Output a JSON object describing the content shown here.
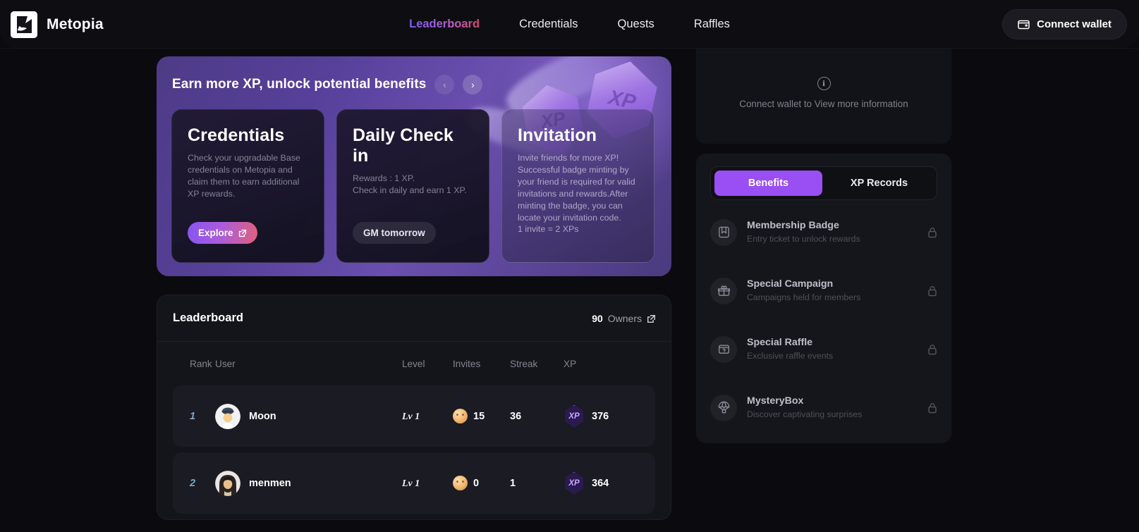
{
  "brand": {
    "name": "Metopia",
    "logo_icon": "metopia-logo-icon"
  },
  "nav": {
    "items": [
      {
        "label": "Leaderboard",
        "active": true
      },
      {
        "label": "Credentials",
        "active": false
      },
      {
        "label": "Quests",
        "active": false
      },
      {
        "label": "Raffles",
        "active": false
      }
    ],
    "wallet_button": {
      "label": "Connect wallet",
      "icon": "wallet-icon"
    }
  },
  "banner": {
    "title": "Earn more XP, unlock potential benefits",
    "prev_label": "‹",
    "next_label": "›",
    "cards": [
      {
        "title": "Credentials",
        "body": "Check your upgradable Base credentials on Metopia and claim them to earn additional XP rewards.",
        "action": "Explore",
        "action_style": "gradient"
      },
      {
        "title": "Daily Check in",
        "body": "Rewards : 1 XP.\nCheck in daily and earn 1 XP.",
        "action": "GM tomorrow",
        "action_style": "ghost"
      },
      {
        "title": "Invitation",
        "body": "Invite friends for more XP! Successful badge minting by your friend is required for valid invitations and rewards.After minting the badge, you can locate your invitation code.\n1 invite = 2 XPs",
        "action": "",
        "action_style": "none"
      }
    ]
  },
  "leaderboard": {
    "title": "Leaderboard",
    "owners_count": "90",
    "owners_label": "Owners",
    "columns": [
      "Rank",
      "User",
      "Level",
      "Invites",
      "Streak",
      "XP"
    ],
    "rows": [
      {
        "rank": "1",
        "user": "Moon",
        "level": "Lv 1",
        "invites": "15",
        "streak": "36",
        "xp": "376",
        "xp_badge": "XP"
      },
      {
        "rank": "2",
        "user": "menmen",
        "level": "Lv 1",
        "invites": "0",
        "streak": "1",
        "xp": "364",
        "xp_badge": "XP"
      }
    ]
  },
  "side": {
    "notice": "Connect wallet to View more information",
    "notice_icon": "info-icon",
    "tabs": [
      {
        "label": "Benefits",
        "active": true
      },
      {
        "label": "XP Records",
        "active": false
      }
    ],
    "benefits": [
      {
        "title": "Membership Badge",
        "subtitle": "Entry ticket to unlock rewards",
        "icon": "bookmark-icon",
        "locked": true
      },
      {
        "title": "Special Campaign",
        "subtitle": "Campaigns held for members",
        "icon": "gift-icon",
        "locked": true
      },
      {
        "title": "Special Raffle",
        "subtitle": "Exclusive raffle events",
        "icon": "raffle-ticket-icon",
        "locked": true
      },
      {
        "title": "MysteryBox",
        "subtitle": "Discover captivating surprises",
        "icon": "parachute-box-icon",
        "locked": true
      }
    ]
  },
  "colors": {
    "accent_purple": "#9a4ff5",
    "accent_pink": "#e0607e",
    "page_bg": "#0b0b0f",
    "panel_bg": "#15161c",
    "banner_purple": "#56409a"
  }
}
